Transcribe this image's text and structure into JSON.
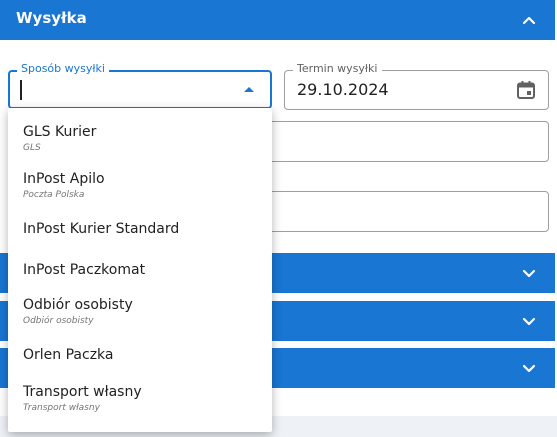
{
  "section": {
    "title": "Wysyłka"
  },
  "shipping_method": {
    "label": "Sposób wysyłki",
    "value": ""
  },
  "ship_date": {
    "label": "Termin wysyłki",
    "value": "29.10.2024"
  },
  "dropdown": {
    "options": [
      {
        "name": "GLS Kurier",
        "sub": "GLS"
      },
      {
        "name": "InPost Apilo",
        "sub": "Poczta Polska"
      },
      {
        "name": "InPost Kurier Standard",
        "sub": ""
      },
      {
        "name": "InPost Paczkomat",
        "sub": ""
      },
      {
        "name": "Odbiór osobisty",
        "sub": "Odbiór osobisty"
      },
      {
        "name": "Orlen Paczka",
        "sub": ""
      },
      {
        "name": "Transport własny",
        "sub": "Transport własny"
      }
    ]
  },
  "colors": {
    "accent": "#1976d2",
    "border": "#9e9e9e"
  },
  "icons": {
    "collapse": "chevron-up-icon",
    "expand": "chevron-down-icon",
    "calendar": "calendar-icon",
    "dropdown": "triangle-up-icon"
  }
}
